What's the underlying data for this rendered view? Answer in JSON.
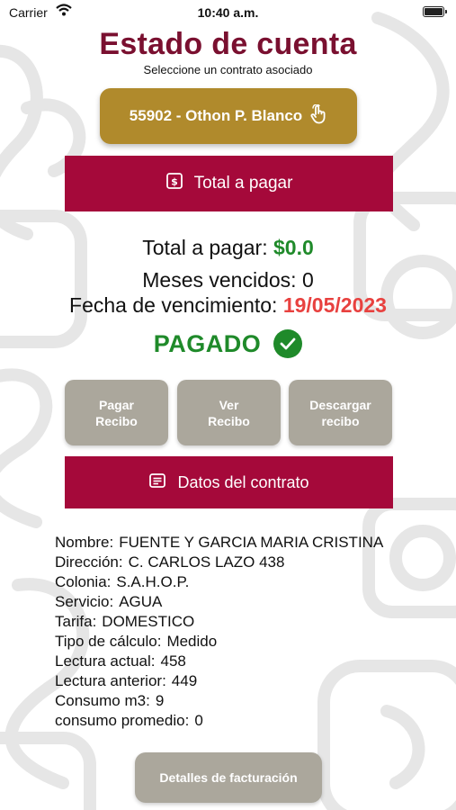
{
  "status_bar": {
    "carrier": "Carrier",
    "time": "10:40 a.m."
  },
  "header": {
    "title": "Estado de cuenta",
    "subtitle": "Seleccione un contrato asociado"
  },
  "contract_selector": {
    "label": "55902 - Othon P. Blanco"
  },
  "total_section": {
    "button_label": "Total a pagar"
  },
  "summary": {
    "total_label": "Total a pagar:",
    "total_value": "$0.0",
    "overdue_label": "Meses vencidos:",
    "overdue_value": "0",
    "due_date_label": "Fecha de vencimiento:",
    "due_date_value": "19/05/2023",
    "status": "PAGADO"
  },
  "actions": {
    "pay": "Pagar Recibo",
    "view": "Ver Recibo",
    "download": "Descargar recibo"
  },
  "contract_section": {
    "button_label": "Datos del contrato"
  },
  "contract_details": [
    {
      "label": "Nombre:",
      "value": "FUENTE Y GARCIA MARIA CRISTINA"
    },
    {
      "label": "Dirección:",
      "value": "C. CARLOS LAZO 438"
    },
    {
      "label": "Colonia:",
      "value": "S.A.H.O.P."
    },
    {
      "label": "Servicio:",
      "value": "AGUA"
    },
    {
      "label": "Tarifa:",
      "value": "DOMESTICO"
    },
    {
      "label": "Tipo de cálculo:",
      "value": "Medido"
    },
    {
      "label": "Lectura actual:",
      "value": "458"
    },
    {
      "label": "Lectura anterior:",
      "value": "449"
    },
    {
      "label": "Consumo m3:",
      "value": "9"
    },
    {
      "label": "consumo promedio:",
      "value": "0"
    }
  ],
  "billing_button": {
    "label": "Detalles de facturación"
  },
  "colors": {
    "title": "#7a1030",
    "crimson": "#a5093a",
    "gold": "#b08a2c",
    "gray_button": "#aba79c",
    "paid_green": "#1f8a2a",
    "due_red": "#e8413f"
  }
}
